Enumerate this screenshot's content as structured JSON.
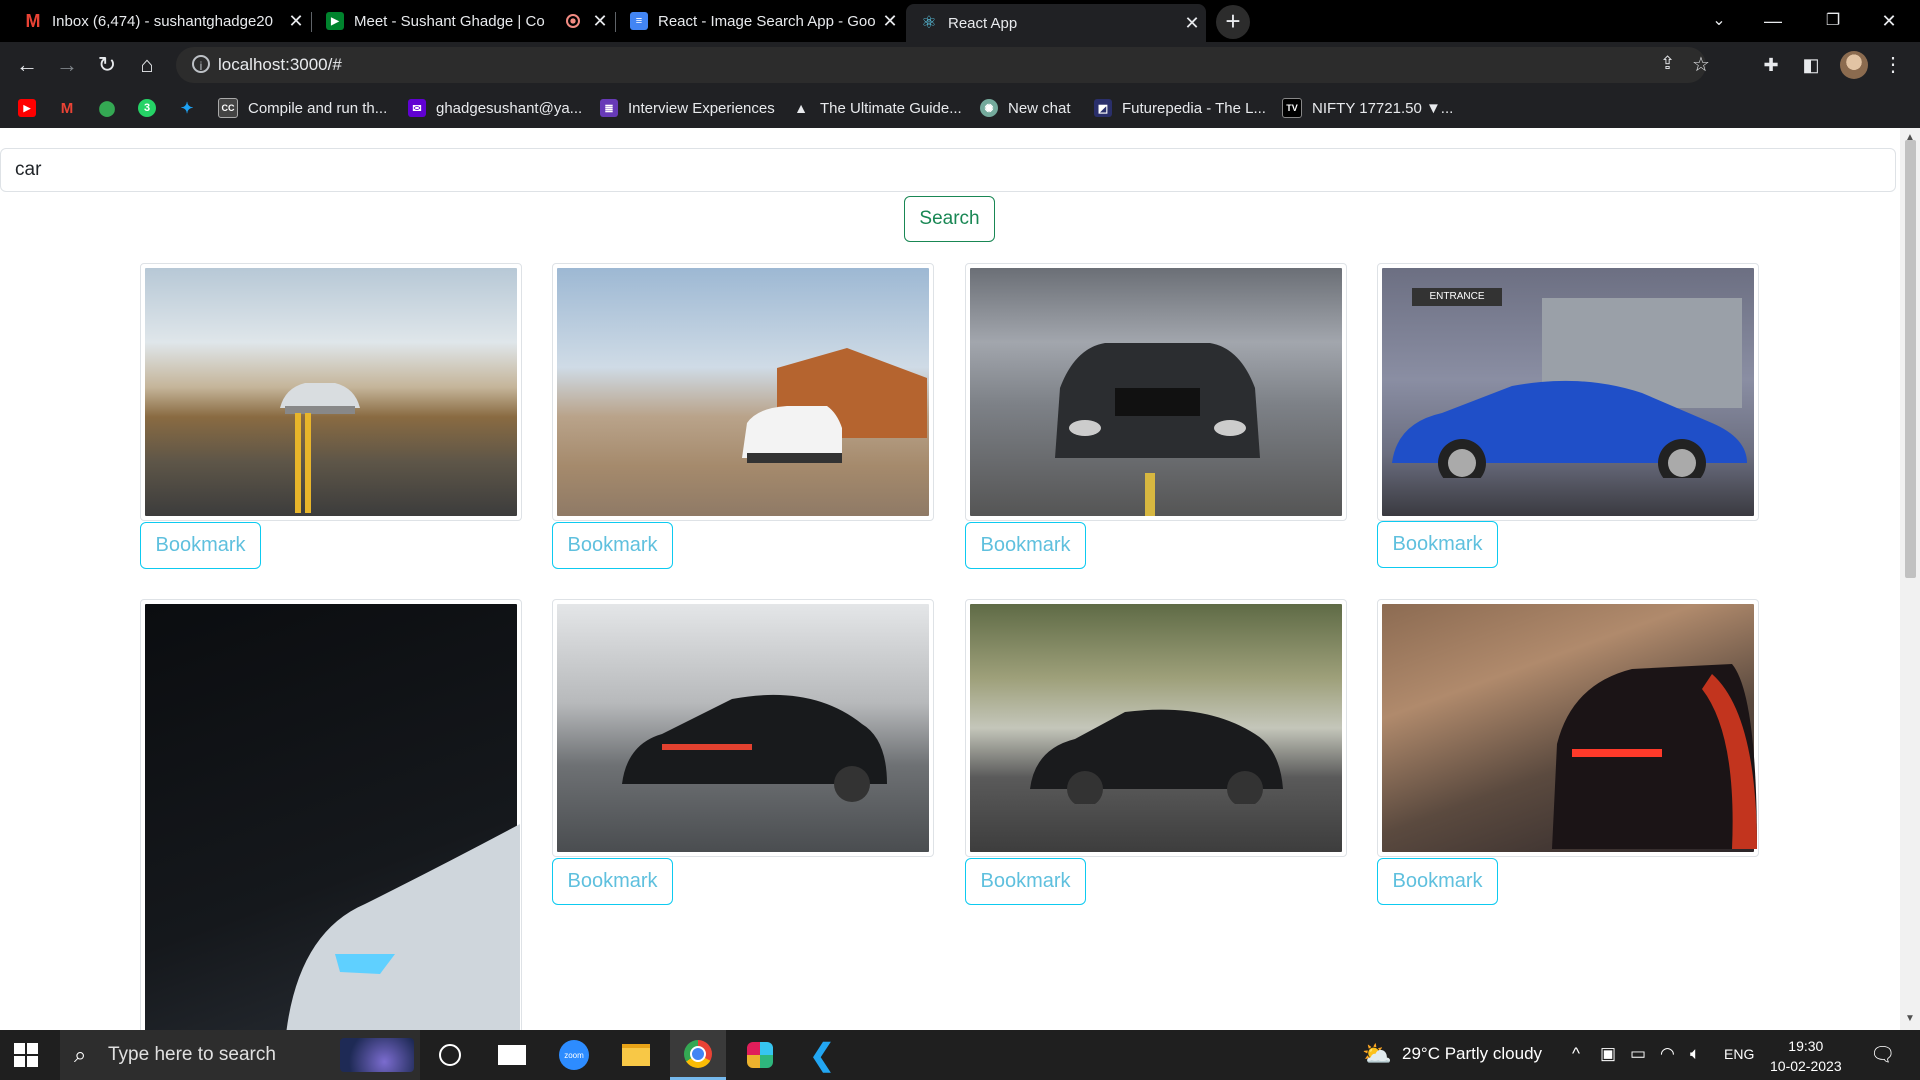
{
  "browser": {
    "tabs": [
      {
        "title": "Inbox (6,474) - sushantghadge20",
        "icon": "gmail-icon"
      },
      {
        "title": "Meet - Sushant Ghadge | Co",
        "icon": "meet-icon"
      },
      {
        "title": "React - Image Search App - Goo",
        "icon": "docs-icon"
      },
      {
        "title": "React App",
        "icon": "react-icon"
      }
    ],
    "url": "localhost:3000/#",
    "bookmarks": [
      {
        "label": "Compile and run th...",
        "icon": "cc-icon"
      },
      {
        "label": "ghadgesushant@ya...",
        "icon": "yahoo-mail-icon"
      },
      {
        "label": "Interview Experiences",
        "icon": "list-icon"
      },
      {
        "label": "The Ultimate Guide...",
        "icon": "mountain-icon"
      },
      {
        "label": "New chat",
        "icon": "openai-icon"
      },
      {
        "label": "Futurepedia - The L...",
        "icon": "futurepedia-icon"
      },
      {
        "label": "NIFTY 17721.50 ▼...",
        "icon": "tradingview-icon"
      }
    ]
  },
  "app": {
    "search_value": "car",
    "search_button": "Search",
    "bookmark_label": "Bookmark",
    "results": [
      {
        "alt": "white sports car on winding road"
      },
      {
        "alt": "white SUV in desert"
      },
      {
        "alt": "black muscle car front"
      },
      {
        "alt": "blue coupe side view"
      },
      {
        "alt": "silver car headlight in dark"
      },
      {
        "alt": "black sedan on highway"
      },
      {
        "alt": "black muscle car under trees"
      },
      {
        "alt": "red sports car tail lights"
      }
    ]
  },
  "taskbar": {
    "search_placeholder": "Type here to search",
    "weather": "29°C  Partly cloudy",
    "language": "ENG",
    "time": "19:30",
    "date": "10-02-2023"
  },
  "colors": {
    "success": "#198754",
    "info": "#0dcaf0",
    "chrome_dark": "#202124"
  }
}
